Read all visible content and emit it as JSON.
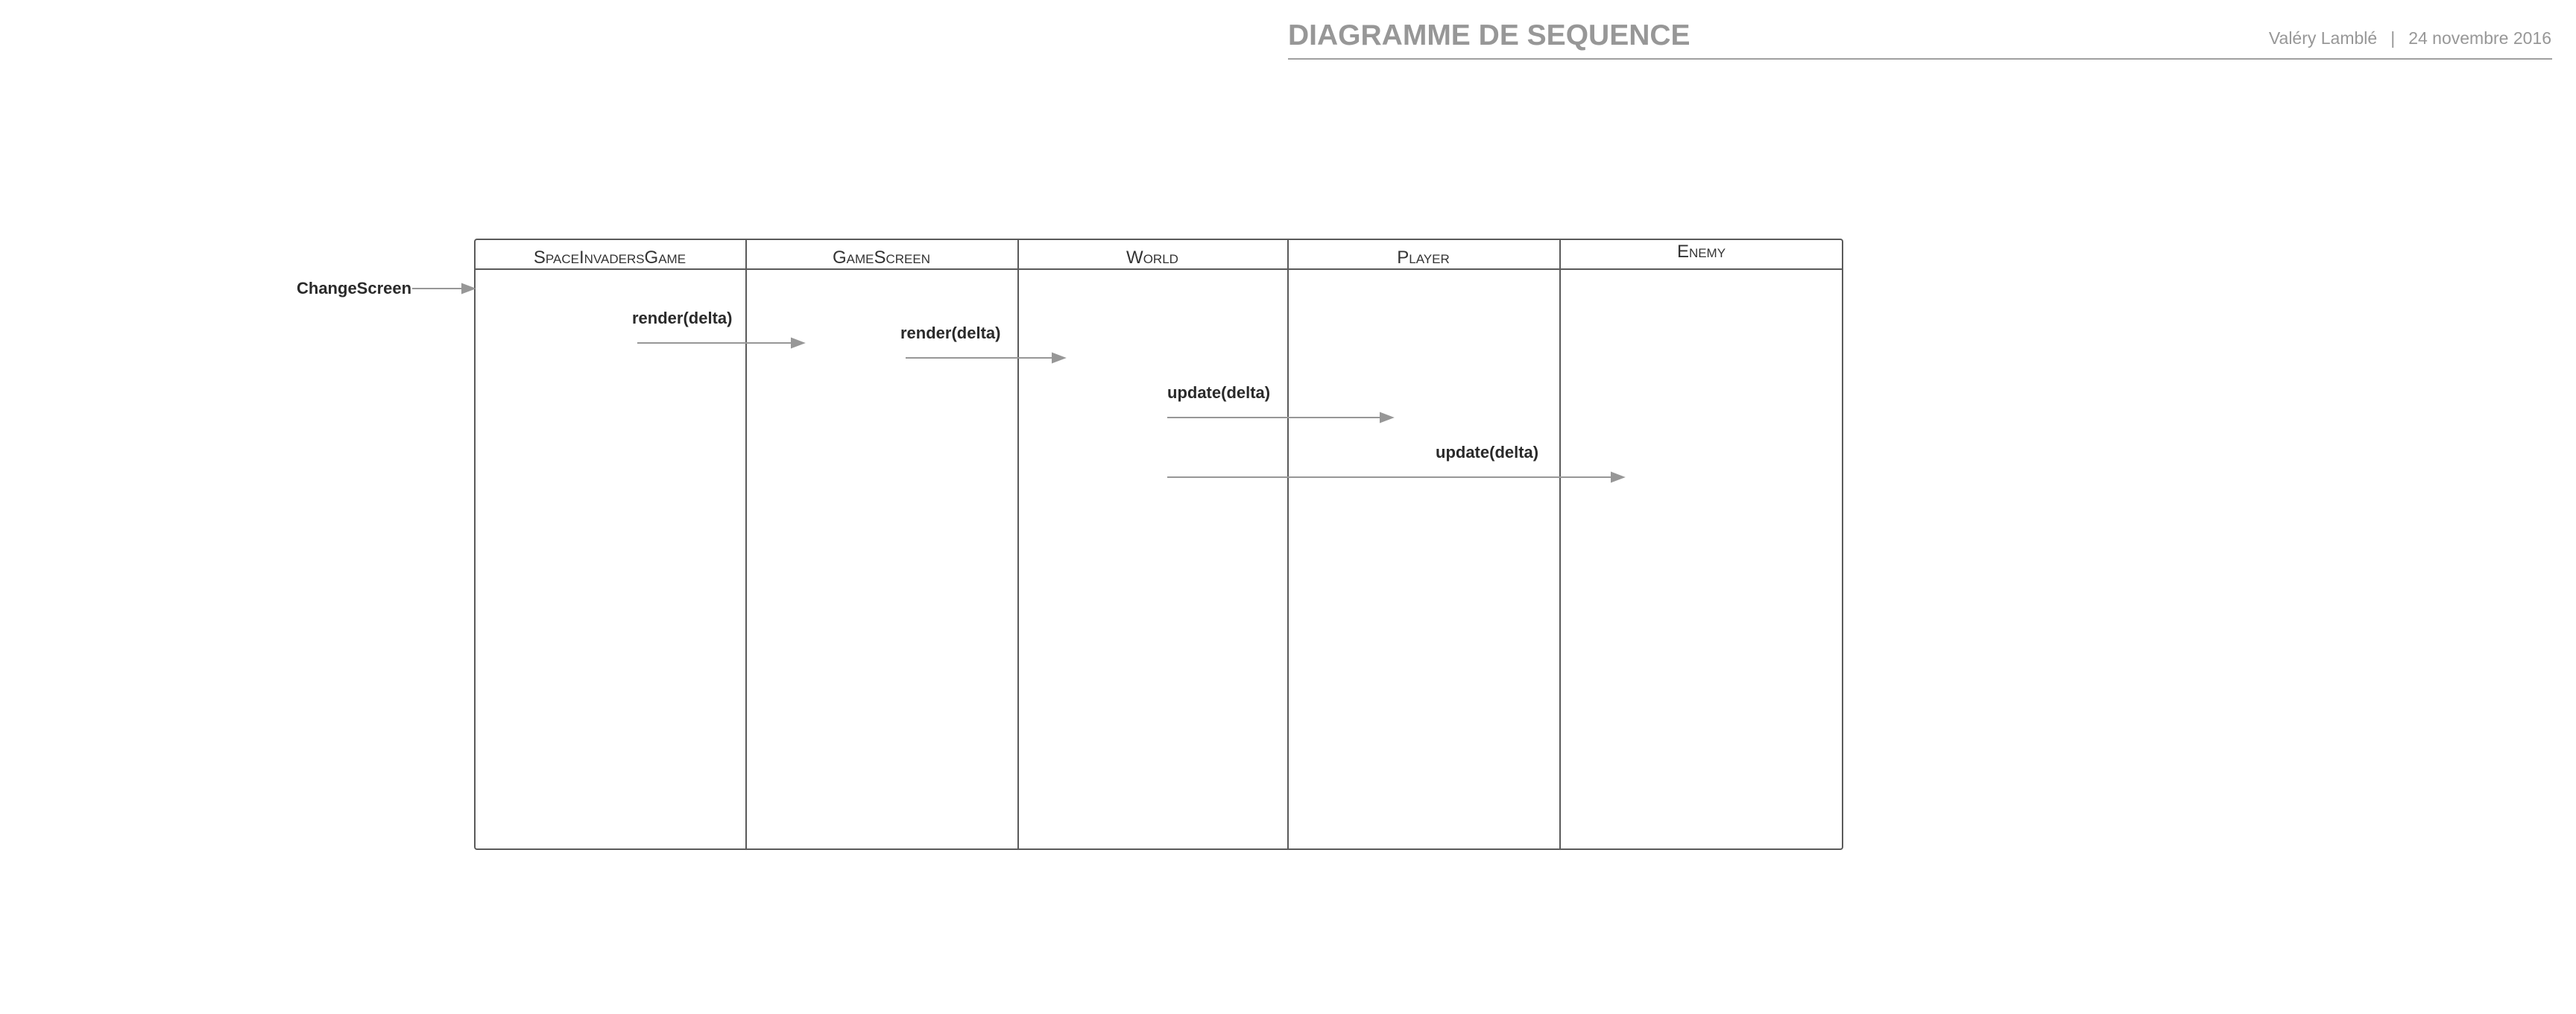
{
  "header": {
    "title": "DIAGRAMME DE SEQUENCE",
    "author": "Valéry Lamblé",
    "separator": "|",
    "date": "24 novembre 2016"
  },
  "lanes": [
    {
      "label": "SpaceInvadersGame"
    },
    {
      "label": "GameScreen"
    },
    {
      "label": "World"
    },
    {
      "label": "Player"
    },
    {
      "label": "Enemy"
    }
  ],
  "messages": [
    {
      "label": "ChangeScreen"
    },
    {
      "label": "render(delta)"
    },
    {
      "label": "render(delta)"
    },
    {
      "label": "update(delta)"
    },
    {
      "label": "update(delta)"
    }
  ],
  "colors": {
    "frame": "#5a5a5a",
    "arrow": "#979797",
    "header_text": "#979797"
  }
}
